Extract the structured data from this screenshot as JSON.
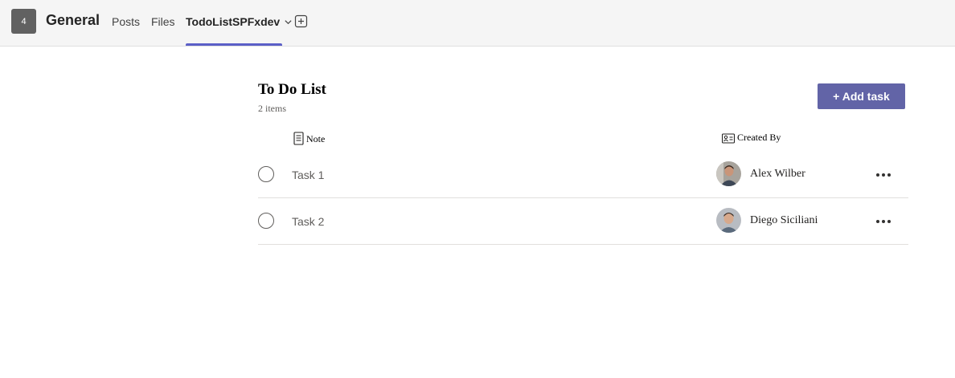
{
  "header": {
    "team_initial": "4",
    "channel": "General",
    "tabs": [
      {
        "label": "Posts"
      },
      {
        "label": "Files"
      },
      {
        "label": "TodoListSPFxdev"
      }
    ],
    "active_tab_icon": "chevron-down-icon",
    "add_tab_icon": "add-tab-icon"
  },
  "list": {
    "title": "To Do List",
    "count": "2 items",
    "add_button_label": "+ Add task",
    "columns": {
      "note": "Note",
      "created_by": "Created By"
    },
    "items": [
      {
        "task": "Task 1",
        "created_by": "Alex Wilber"
      },
      {
        "task": "Task 2",
        "created_by": "Diego Siciliani"
      }
    ]
  },
  "colors": {
    "accent": "#5b5fc7",
    "button": "#6264a7"
  }
}
